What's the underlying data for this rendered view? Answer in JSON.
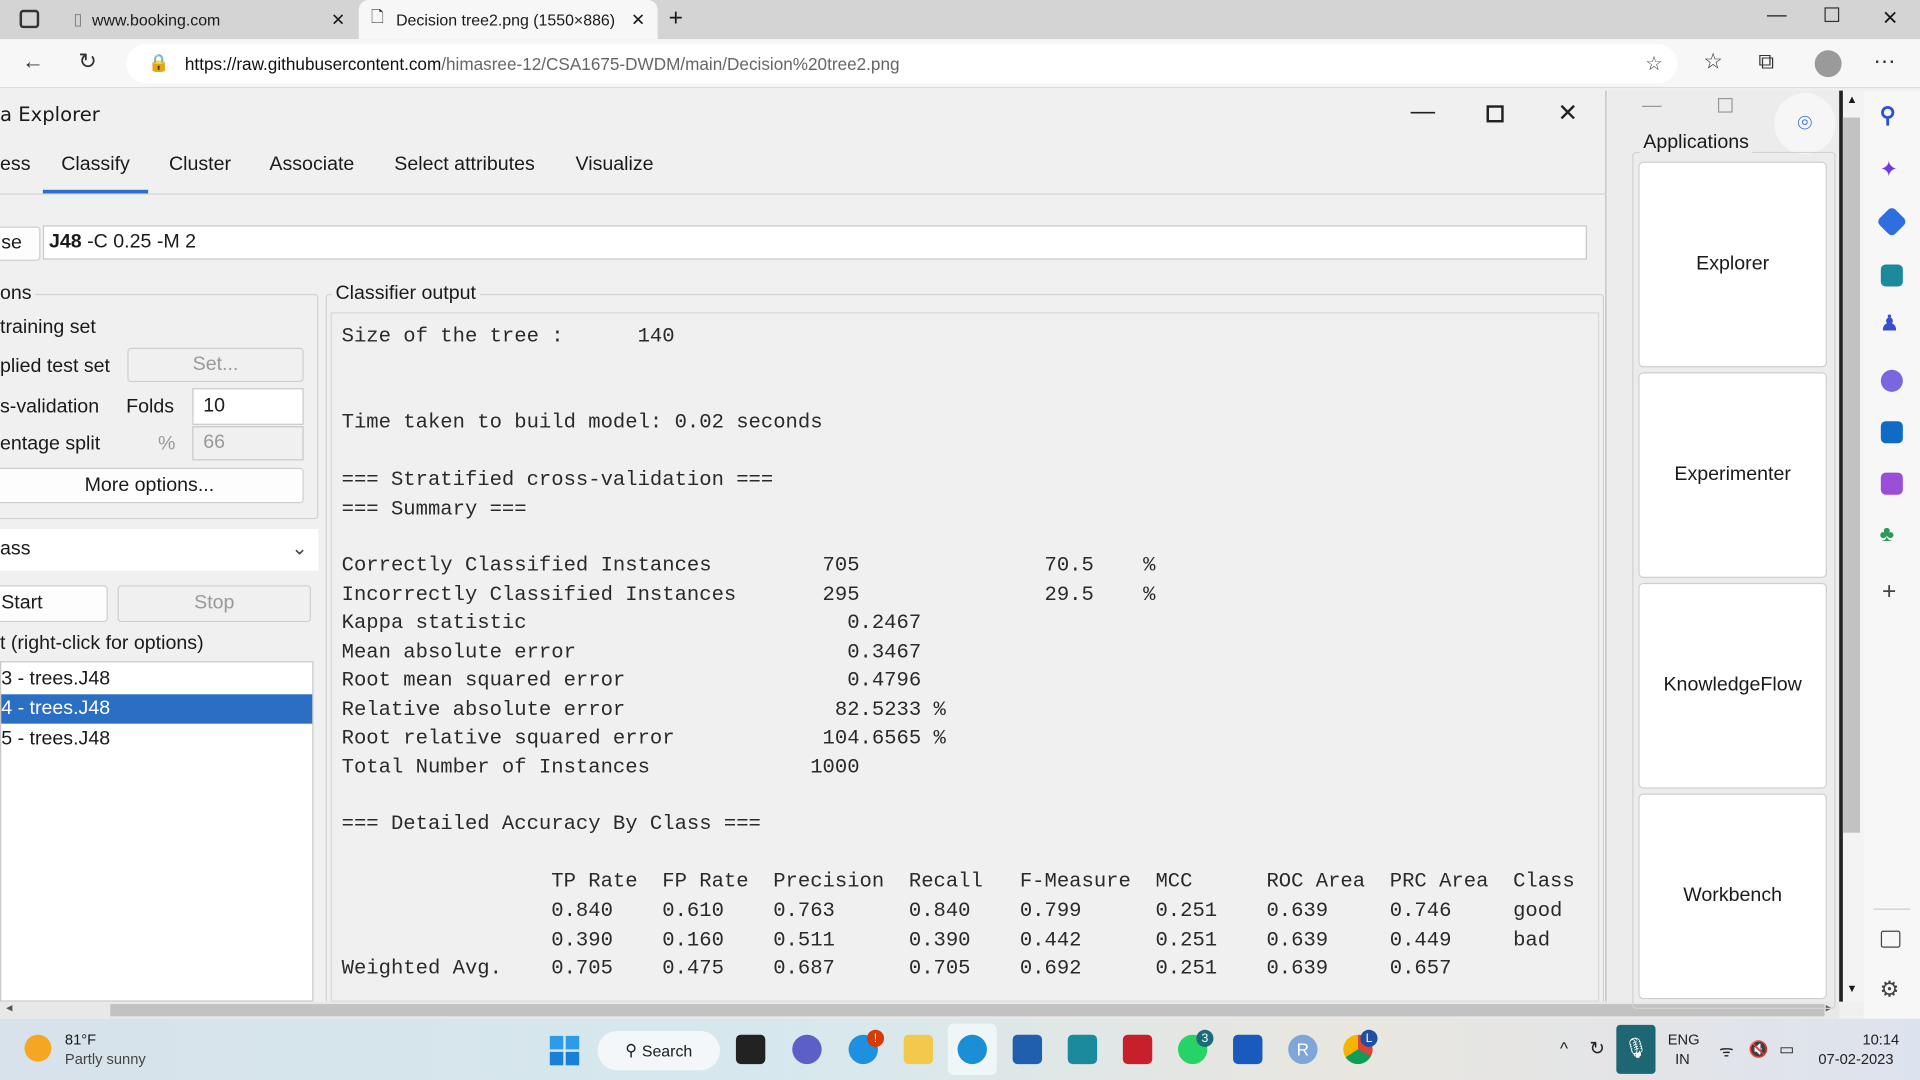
{
  "browser": {
    "tabs": [
      {
        "label": "www.booking.com",
        "active": false
      },
      {
        "label": "Decision tree2.png (1550×886)",
        "active": true
      }
    ],
    "url_host": "https://raw.githubusercontent.com",
    "url_path": "/himasree-12/CSA1675-DWDM/main/Decision%20tree2.png"
  },
  "weka": {
    "title": "a Explorer",
    "tabs": [
      "ess",
      "Classify",
      "Cluster",
      "Associate",
      "Select attributes",
      "Visualize"
    ],
    "active_tab": "Classify",
    "choose_label": "se",
    "classifier_name": "J48",
    "classifier_options": "-C 0.25 -M 2",
    "test_options": {
      "title": "ons",
      "use_training": "training set",
      "supplied_test": "plied test set",
      "set_button": "Set...",
      "cross_validation": "s-validation",
      "folds_label": "Folds",
      "folds_value": "10",
      "percentage_split": "entage split",
      "percent_sign": "%",
      "percent_value": "66",
      "more_options": "More options..."
    },
    "class_select": "ass",
    "start_label": "Start",
    "stop_label": "Stop",
    "result_list_title": "t (right-click for options)",
    "results": [
      {
        "label": "3 - trees.J48",
        "selected": false
      },
      {
        "label": "4 - trees.J48",
        "selected": true
      },
      {
        "label": "5 - trees.J48",
        "selected": false
      }
    ],
    "output_title": "Classifier output",
    "output": {
      "size_line": "Size of the tree :      140",
      "time_line": "Time taken to build model: 0.02 seconds",
      "stratified": "=== Stratified cross-validation ===",
      "summary": "=== Summary ===",
      "stats": [
        {
          "label": "Correctly Classified Instances",
          "value": "705",
          "pct": "70.5",
          "unit": "%"
        },
        {
          "label": "Incorrectly Classified Instances",
          "value": "295",
          "pct": "29.5",
          "unit": "%"
        },
        {
          "label": "Kappa statistic",
          "value": "0.2467"
        },
        {
          "label": "Mean absolute error",
          "value": "0.3467"
        },
        {
          "label": "Root mean squared error",
          "value": "0.4796"
        },
        {
          "label": "Relative absolute error",
          "value": "82.5233 %"
        },
        {
          "label": "Root relative squared error",
          "value": "104.6565 %"
        },
        {
          "label": "Total Number of Instances",
          "value": "1000"
        }
      ],
      "detailed": "=== Detailed Accuracy By Class ===",
      "columns": [
        "TP Rate",
        "FP Rate",
        "Precision",
        "Recall",
        "F-Measure",
        "MCC",
        "ROC Area",
        "PRC Area",
        "Class"
      ],
      "rows": [
        {
          "label": "",
          "values": [
            "0.840",
            "0.610",
            "0.763",
            "0.840",
            "0.799",
            "0.251",
            "0.639",
            "0.746",
            "good"
          ]
        },
        {
          "label": "",
          "values": [
            "0.390",
            "0.160",
            "0.511",
            "0.390",
            "0.442",
            "0.251",
            "0.639",
            "0.449",
            "bad"
          ]
        },
        {
          "label": "Weighted Avg.",
          "values": [
            "0.705",
            "0.475",
            "0.687",
            "0.705",
            "0.692",
            "0.251",
            "0.639",
            "0.657",
            ""
          ]
        }
      ]
    }
  },
  "chooser": {
    "title": "Applications",
    "apps": [
      "Explorer",
      "Experimenter",
      "KnowledgeFlow",
      "Workbench"
    ]
  },
  "taskbar": {
    "weather_temp": "81°F",
    "weather_desc": "Partly sunny",
    "search_label": "Search",
    "whatsapp_badge": "3",
    "chrome_badge": "L",
    "lang": "ENG",
    "region": "IN",
    "time": "10:14",
    "date": "07-02-2023"
  },
  "colors": {
    "selection": "#2a6fc4",
    "tab_underline": "#2c6fc9",
    "mic_tile": "#1e6673"
  }
}
